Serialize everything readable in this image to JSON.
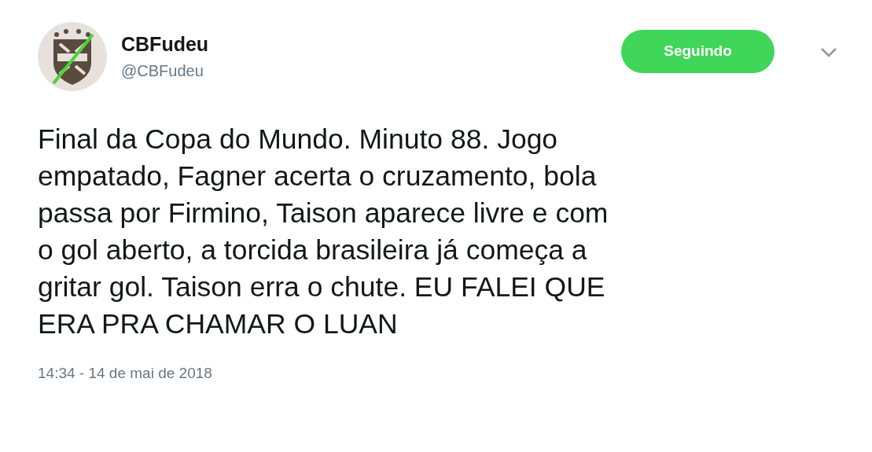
{
  "author": {
    "name": "CBFudeu",
    "handle": "@CBFudeu"
  },
  "follow_button": {
    "label": "Seguindo",
    "following": true
  },
  "tweet": {
    "text": "Final da Copa do Mundo. Minuto 88. Jogo\nempatado, Fagner acerta o cruzamento, bola\npassa por Firmino, Taison aparece livre e com\no gol aberto, a torcida brasileira já começa a\ngritar gol. Taison erra o chute. EU FALEI QUE\nERA PRA CHAMAR O LUAN",
    "timestamp": "14:34 - 14 de mai de 2018"
  }
}
